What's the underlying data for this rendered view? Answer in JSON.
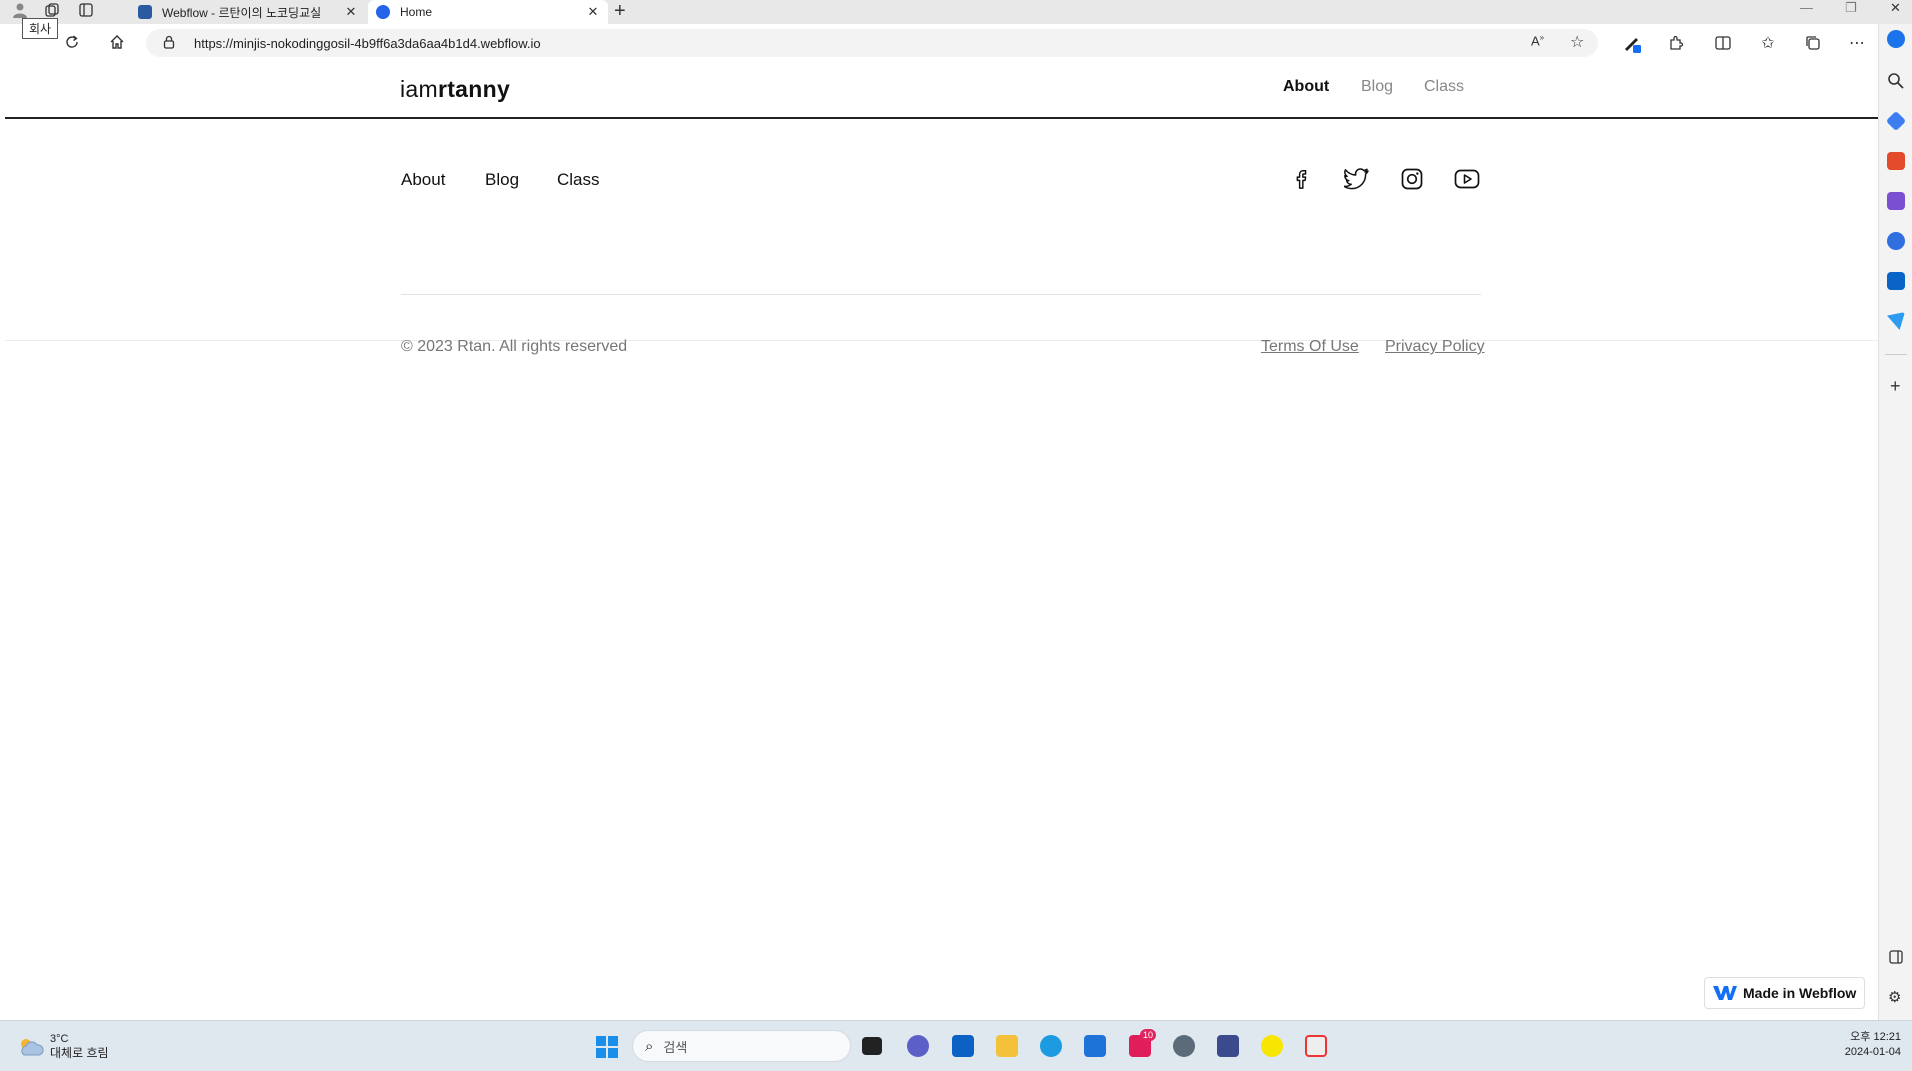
{
  "browser": {
    "tooltip": "회사",
    "tabs": [
      {
        "title": "Webflow - 르탄이의 노코딩교실",
        "active": false
      },
      {
        "title": "Home",
        "active": true
      }
    ],
    "url": "https://minjis-nokodinggosil-4b9ff6a3da6aa4b1d4.webflow.io"
  },
  "site": {
    "logo_light": "iam",
    "logo_bold": "rtanny",
    "header_nav": [
      {
        "label": "About",
        "active": true
      },
      {
        "label": "Blog",
        "active": false
      },
      {
        "label": "Class",
        "active": false
      }
    ],
    "footer_nav": [
      "About",
      "Blog",
      "Class"
    ],
    "social_icons": [
      "facebook-icon",
      "twitter-icon",
      "instagram-icon",
      "youtube-icon"
    ],
    "copyright": "© 2023 Rtan. All rights reserved",
    "legal_links": [
      "Terms Of Use",
      "Privacy Policy"
    ],
    "badge": "Made in Webflow"
  },
  "taskbar": {
    "weather_temp": "3°C",
    "weather_desc": "대체로 흐림",
    "search_placeholder": "검색",
    "notification_count": "10",
    "time": "오후 12:21",
    "date": "2024-01-04"
  },
  "colors": {
    "accent_blue": "#146ef5",
    "text_dark": "#111111",
    "text_muted": "#888888"
  }
}
